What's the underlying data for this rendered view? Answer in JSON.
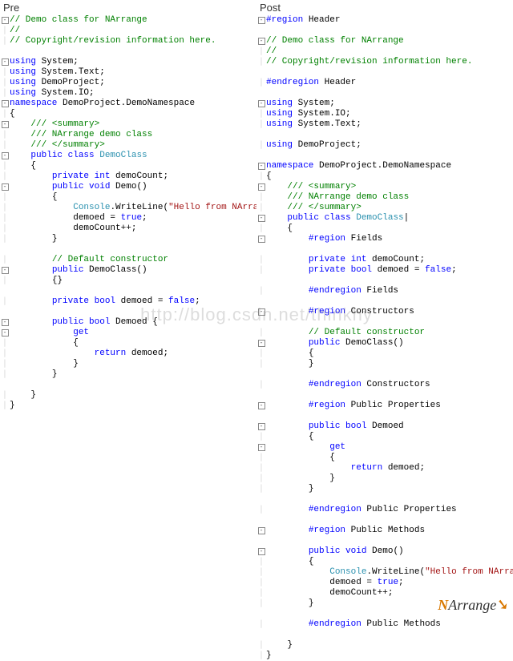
{
  "titles": {
    "pre": "Pre",
    "post": "Post"
  },
  "watermark": "http://blog.csdn.net/thinkhy",
  "logo": {
    "n": "N",
    "rest": "Arrange",
    "arrow": "➘"
  },
  "fold": {
    "minus": "-",
    "plus": "+",
    "bar": "│"
  },
  "pre_lines": [
    {
      "g": "m",
      "t": [
        {
          "c": "c-comment",
          "v": "// Demo class for NArrange"
        }
      ]
    },
    {
      "g": "b",
      "t": [
        {
          "c": "c-comment",
          "v": "//"
        }
      ]
    },
    {
      "g": "b",
      "t": [
        {
          "c": "c-comment",
          "v": "// Copyright/revision information here."
        }
      ]
    },
    {
      "g": "",
      "t": []
    },
    {
      "g": "m",
      "t": [
        {
          "c": "c-keyword",
          "v": "using"
        },
        {
          "c": "c-plain",
          "v": " System;"
        }
      ]
    },
    {
      "g": "b",
      "t": [
        {
          "c": "c-keyword",
          "v": "using"
        },
        {
          "c": "c-plain",
          "v": " System.Text;"
        }
      ]
    },
    {
      "g": "b",
      "t": [
        {
          "c": "c-keyword",
          "v": "using"
        },
        {
          "c": "c-plain",
          "v": " DemoProject;"
        }
      ]
    },
    {
      "g": "b",
      "t": [
        {
          "c": "c-keyword",
          "v": "using"
        },
        {
          "c": "c-plain",
          "v": " System.IO;"
        }
      ]
    },
    {
      "g": "m",
      "t": [
        {
          "c": "c-keyword",
          "v": "namespace"
        },
        {
          "c": "c-plain",
          "v": " DemoProject.DemoNamespace"
        }
      ]
    },
    {
      "g": "b",
      "t": [
        {
          "c": "c-plain",
          "v": "{"
        }
      ]
    },
    {
      "g": "m",
      "i": 1,
      "t": [
        {
          "c": "c-comment",
          "v": "/// <summary>"
        }
      ]
    },
    {
      "g": "b",
      "i": 1,
      "t": [
        {
          "c": "c-comment",
          "v": "/// NArrange demo class"
        }
      ]
    },
    {
      "g": "b",
      "i": 1,
      "t": [
        {
          "c": "c-comment",
          "v": "/// </summary>"
        }
      ]
    },
    {
      "g": "m",
      "i": 1,
      "t": [
        {
          "c": "c-keyword",
          "v": "public class"
        },
        {
          "c": "c-plain",
          "v": " "
        },
        {
          "c": "c-type",
          "v": "DemoClass"
        }
      ]
    },
    {
      "g": "b",
      "i": 1,
      "t": [
        {
          "c": "c-plain",
          "v": "{"
        }
      ]
    },
    {
      "g": "b",
      "i": 2,
      "t": [
        {
          "c": "c-keyword",
          "v": "private int"
        },
        {
          "c": "c-plain",
          "v": " demoCount;"
        }
      ]
    },
    {
      "g": "m",
      "i": 2,
      "t": [
        {
          "c": "c-keyword",
          "v": "public void"
        },
        {
          "c": "c-plain",
          "v": " Demo()"
        }
      ]
    },
    {
      "g": "b",
      "i": 2,
      "t": [
        {
          "c": "c-plain",
          "v": "{"
        }
      ]
    },
    {
      "g": "b",
      "i": 3,
      "t": [
        {
          "c": "c-type",
          "v": "Console"
        },
        {
          "c": "c-plain",
          "v": ".WriteLine("
        },
        {
          "c": "c-string",
          "v": "\"Hello from NArrange!\""
        },
        {
          "c": "c-plain",
          "v": ");"
        }
      ]
    },
    {
      "g": "b",
      "i": 3,
      "t": [
        {
          "c": "c-plain",
          "v": "demoed = "
        },
        {
          "c": "c-keyword",
          "v": "true"
        },
        {
          "c": "c-plain",
          "v": ";"
        }
      ]
    },
    {
      "g": "b",
      "i": 3,
      "t": [
        {
          "c": "c-plain",
          "v": "demoCount++;"
        }
      ]
    },
    {
      "g": "b",
      "i": 2,
      "t": [
        {
          "c": "c-plain",
          "v": "}"
        }
      ]
    },
    {
      "g": "",
      "t": []
    },
    {
      "g": "b",
      "i": 2,
      "t": [
        {
          "c": "c-comment",
          "v": "// Default constructor"
        }
      ]
    },
    {
      "g": "m",
      "i": 2,
      "t": [
        {
          "c": "c-keyword",
          "v": "public"
        },
        {
          "c": "c-plain",
          "v": " DemoClass()"
        }
      ]
    },
    {
      "g": "b",
      "i": 2,
      "t": [
        {
          "c": "c-plain",
          "v": "{}"
        }
      ]
    },
    {
      "g": "",
      "t": []
    },
    {
      "g": "b",
      "i": 2,
      "t": [
        {
          "c": "c-keyword",
          "v": "private bool"
        },
        {
          "c": "c-plain",
          "v": " demoed = "
        },
        {
          "c": "c-keyword",
          "v": "false"
        },
        {
          "c": "c-plain",
          "v": ";"
        }
      ]
    },
    {
      "g": "",
      "t": []
    },
    {
      "g": "m",
      "i": 2,
      "t": [
        {
          "c": "c-keyword",
          "v": "public bool"
        },
        {
          "c": "c-plain",
          "v": " Demoed {"
        }
      ]
    },
    {
      "g": "m",
      "i": 3,
      "t": [
        {
          "c": "c-keyword",
          "v": "get"
        }
      ]
    },
    {
      "g": "b",
      "i": 3,
      "t": [
        {
          "c": "c-plain",
          "v": "{"
        }
      ]
    },
    {
      "g": "b",
      "i": 4,
      "t": [
        {
          "c": "c-keyword",
          "v": "return"
        },
        {
          "c": "c-plain",
          "v": " demoed;"
        }
      ]
    },
    {
      "g": "b",
      "i": 3,
      "t": [
        {
          "c": "c-plain",
          "v": "}"
        }
      ]
    },
    {
      "g": "b",
      "i": 2,
      "t": [
        {
          "c": "c-plain",
          "v": "}"
        }
      ]
    },
    {
      "g": "",
      "t": []
    },
    {
      "g": "b",
      "i": 1,
      "t": [
        {
          "c": "c-plain",
          "v": "}"
        }
      ]
    },
    {
      "g": "b",
      "t": [
        {
          "c": "c-plain",
          "v": "}"
        }
      ]
    }
  ],
  "post_lines": [
    {
      "g": "m",
      "t": [
        {
          "c": "c-keyword",
          "v": "#region"
        },
        {
          "c": "c-plain",
          "v": " Header"
        }
      ]
    },
    {
      "g": "",
      "t": []
    },
    {
      "g": "m",
      "t": [
        {
          "c": "c-comment",
          "v": "// Demo class for NArrange"
        }
      ]
    },
    {
      "g": "b",
      "t": [
        {
          "c": "c-comment",
          "v": "//"
        }
      ]
    },
    {
      "g": "b",
      "t": [
        {
          "c": "c-comment",
          "v": "// Copyright/revision information here."
        }
      ]
    },
    {
      "g": "",
      "t": []
    },
    {
      "g": "b",
      "t": [
        {
          "c": "c-keyword",
          "v": "#endregion"
        },
        {
          "c": "c-plain",
          "v": " Header"
        }
      ]
    },
    {
      "g": "",
      "t": []
    },
    {
      "g": "m",
      "t": [
        {
          "c": "c-keyword",
          "v": "using"
        },
        {
          "c": "c-plain",
          "v": " System;"
        }
      ]
    },
    {
      "g": "b",
      "t": [
        {
          "c": "c-keyword",
          "v": "using"
        },
        {
          "c": "c-plain",
          "v": " System.IO;"
        }
      ]
    },
    {
      "g": "b",
      "t": [
        {
          "c": "c-keyword",
          "v": "using"
        },
        {
          "c": "c-plain",
          "v": " System.Text;"
        }
      ]
    },
    {
      "g": "",
      "t": []
    },
    {
      "g": "b",
      "t": [
        {
          "c": "c-keyword",
          "v": "using"
        },
        {
          "c": "c-plain",
          "v": " DemoProject;"
        }
      ]
    },
    {
      "g": "",
      "t": []
    },
    {
      "g": "m",
      "t": [
        {
          "c": "c-keyword",
          "v": "namespace"
        },
        {
          "c": "c-plain",
          "v": " DemoProject.DemoNamespace"
        }
      ]
    },
    {
      "g": "b",
      "t": [
        {
          "c": "c-plain",
          "v": "{"
        }
      ]
    },
    {
      "g": "m",
      "i": 1,
      "t": [
        {
          "c": "c-comment",
          "v": "/// <summary>"
        }
      ]
    },
    {
      "g": "b",
      "i": 1,
      "t": [
        {
          "c": "c-comment",
          "v": "/// NArrange demo class"
        }
      ]
    },
    {
      "g": "b",
      "i": 1,
      "t": [
        {
          "c": "c-comment",
          "v": "/// </summary>"
        }
      ]
    },
    {
      "g": "m",
      "i": 1,
      "t": [
        {
          "c": "c-keyword",
          "v": "public class"
        },
        {
          "c": "c-plain",
          "v": " "
        },
        {
          "c": "c-type",
          "v": "DemoClass"
        },
        {
          "c": "c-plain",
          "v": "|"
        }
      ]
    },
    {
      "g": "b",
      "i": 1,
      "t": [
        {
          "c": "c-plain",
          "v": "{"
        }
      ]
    },
    {
      "g": "m",
      "i": 2,
      "t": [
        {
          "c": "c-keyword",
          "v": "#region"
        },
        {
          "c": "c-plain",
          "v": " Fields"
        }
      ]
    },
    {
      "g": "",
      "t": []
    },
    {
      "g": "b",
      "i": 2,
      "t": [
        {
          "c": "c-keyword",
          "v": "private int"
        },
        {
          "c": "c-plain",
          "v": " demoCount;"
        }
      ]
    },
    {
      "g": "b",
      "i": 2,
      "t": [
        {
          "c": "c-keyword",
          "v": "private bool"
        },
        {
          "c": "c-plain",
          "v": " demoed = "
        },
        {
          "c": "c-keyword",
          "v": "false"
        },
        {
          "c": "c-plain",
          "v": ";"
        }
      ]
    },
    {
      "g": "",
      "t": []
    },
    {
      "g": "b",
      "i": 2,
      "t": [
        {
          "c": "c-keyword",
          "v": "#endregion"
        },
        {
          "c": "c-plain",
          "v": " Fields"
        }
      ]
    },
    {
      "g": "",
      "t": []
    },
    {
      "g": "m",
      "i": 2,
      "t": [
        {
          "c": "c-keyword",
          "v": "#region"
        },
        {
          "c": "c-plain",
          "v": " Constructors"
        }
      ]
    },
    {
      "g": "",
      "t": []
    },
    {
      "g": "b",
      "i": 2,
      "t": [
        {
          "c": "c-comment",
          "v": "// Default constructor"
        }
      ]
    },
    {
      "g": "m",
      "i": 2,
      "t": [
        {
          "c": "c-keyword",
          "v": "public"
        },
        {
          "c": "c-plain",
          "v": " DemoClass()"
        }
      ]
    },
    {
      "g": "b",
      "i": 2,
      "t": [
        {
          "c": "c-plain",
          "v": "{"
        }
      ]
    },
    {
      "g": "b",
      "i": 2,
      "t": [
        {
          "c": "c-plain",
          "v": "}"
        }
      ]
    },
    {
      "g": "",
      "t": []
    },
    {
      "g": "b",
      "i": 2,
      "t": [
        {
          "c": "c-keyword",
          "v": "#endregion"
        },
        {
          "c": "c-plain",
          "v": " Constructors"
        }
      ]
    },
    {
      "g": "",
      "t": []
    },
    {
      "g": "m",
      "i": 2,
      "t": [
        {
          "c": "c-keyword",
          "v": "#region"
        },
        {
          "c": "c-plain",
          "v": " Public Properties"
        }
      ]
    },
    {
      "g": "",
      "t": []
    },
    {
      "g": "m",
      "i": 2,
      "t": [
        {
          "c": "c-keyword",
          "v": "public bool"
        },
        {
          "c": "c-plain",
          "v": " Demoed"
        }
      ]
    },
    {
      "g": "b",
      "i": 2,
      "t": [
        {
          "c": "c-plain",
          "v": "{"
        }
      ]
    },
    {
      "g": "m",
      "i": 3,
      "t": [
        {
          "c": "c-keyword",
          "v": "get"
        }
      ]
    },
    {
      "g": "b",
      "i": 3,
      "t": [
        {
          "c": "c-plain",
          "v": "{"
        }
      ]
    },
    {
      "g": "b",
      "i": 4,
      "t": [
        {
          "c": "c-keyword",
          "v": "return"
        },
        {
          "c": "c-plain",
          "v": " demoed;"
        }
      ]
    },
    {
      "g": "b",
      "i": 3,
      "t": [
        {
          "c": "c-plain",
          "v": "}"
        }
      ]
    },
    {
      "g": "b",
      "i": 2,
      "t": [
        {
          "c": "c-plain",
          "v": "}"
        }
      ]
    },
    {
      "g": "",
      "t": []
    },
    {
      "g": "b",
      "i": 2,
      "t": [
        {
          "c": "c-keyword",
          "v": "#endregion"
        },
        {
          "c": "c-plain",
          "v": " Public Properties"
        }
      ]
    },
    {
      "g": "",
      "t": []
    },
    {
      "g": "m",
      "i": 2,
      "t": [
        {
          "c": "c-keyword",
          "v": "#region"
        },
        {
          "c": "c-plain",
          "v": " Public Methods"
        }
      ]
    },
    {
      "g": "",
      "t": []
    },
    {
      "g": "m",
      "i": 2,
      "t": [
        {
          "c": "c-keyword",
          "v": "public void"
        },
        {
          "c": "c-plain",
          "v": " Demo()"
        }
      ]
    },
    {
      "g": "b",
      "i": 2,
      "t": [
        {
          "c": "c-plain",
          "v": "{"
        }
      ]
    },
    {
      "g": "b",
      "i": 3,
      "t": [
        {
          "c": "c-type",
          "v": "Console"
        },
        {
          "c": "c-plain",
          "v": ".WriteLine("
        },
        {
          "c": "c-string",
          "v": "\"Hello from NArrange!\""
        },
        {
          "c": "c-plain",
          "v": ");"
        }
      ]
    },
    {
      "g": "b",
      "i": 3,
      "t": [
        {
          "c": "c-plain",
          "v": "demoed = "
        },
        {
          "c": "c-keyword",
          "v": "true"
        },
        {
          "c": "c-plain",
          "v": ";"
        }
      ]
    },
    {
      "g": "b",
      "i": 3,
      "t": [
        {
          "c": "c-plain",
          "v": "demoCount++;"
        }
      ]
    },
    {
      "g": "b",
      "i": 2,
      "t": [
        {
          "c": "c-plain",
          "v": "}"
        }
      ]
    },
    {
      "g": "",
      "t": []
    },
    {
      "g": "b",
      "i": 2,
      "t": [
        {
          "c": "c-keyword",
          "v": "#endregion"
        },
        {
          "c": "c-plain",
          "v": " Public Methods"
        }
      ]
    },
    {
      "g": "",
      "t": []
    },
    {
      "g": "b",
      "i": 1,
      "t": [
        {
          "c": "c-plain",
          "v": "}"
        }
      ]
    },
    {
      "g": "b",
      "t": [
        {
          "c": "c-plain",
          "v": "}"
        }
      ]
    }
  ]
}
